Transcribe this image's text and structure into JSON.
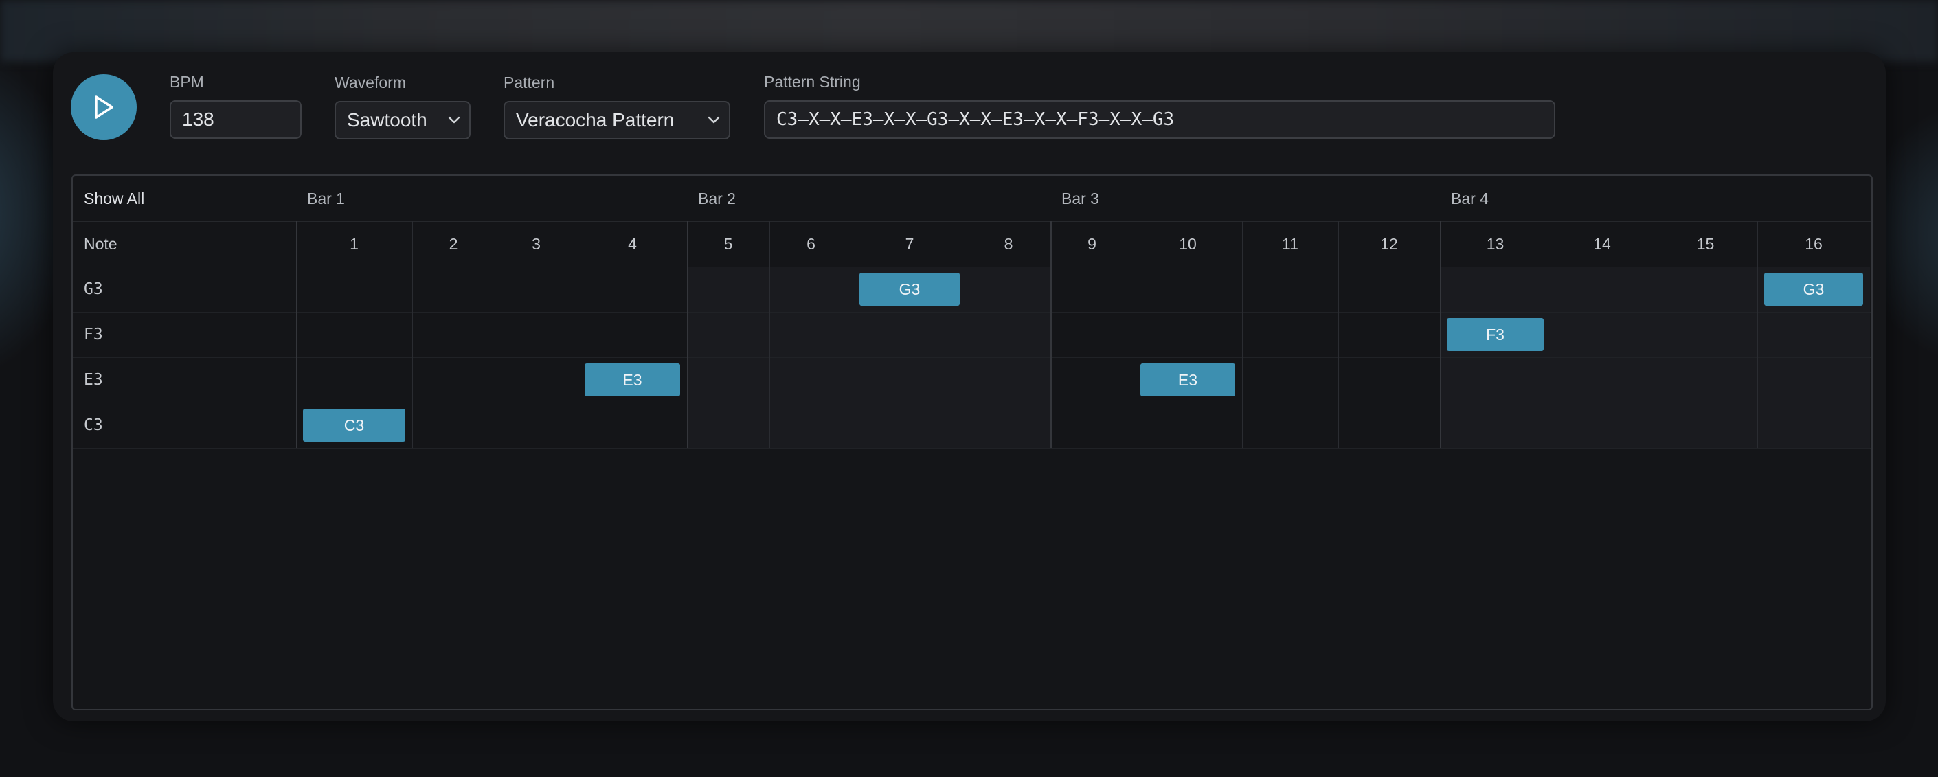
{
  "controls": {
    "bpm_label": "BPM",
    "bpm_value": "138",
    "waveform_label": "Waveform",
    "waveform_value": "Sawtooth",
    "pattern_label": "Pattern",
    "pattern_value": "Veracocha Pattern",
    "pattern_string_label": "Pattern String",
    "pattern_string_value": "C3–X–X–E3–X–X–G3–X–X–E3–X–X–F3–X–X–G3"
  },
  "grid": {
    "show_all_label": "Show All",
    "note_header": "Note",
    "bars": [
      "Bar 1",
      "Bar 2",
      "Bar 3",
      "Bar 4"
    ],
    "steps": [
      "1",
      "2",
      "3",
      "4",
      "5",
      "6",
      "7",
      "8",
      "9",
      "10",
      "11",
      "12",
      "13",
      "14",
      "15",
      "16"
    ],
    "rows": [
      "G3",
      "F3",
      "E3",
      "C3"
    ],
    "notes": [
      {
        "note": "C3",
        "step": 1
      },
      {
        "note": "E3",
        "step": 4
      },
      {
        "note": "G3",
        "step": 7
      },
      {
        "note": "E3",
        "step": 10
      },
      {
        "note": "F3",
        "step": 13
      },
      {
        "note": "G3",
        "step": 16
      }
    ]
  },
  "colors": {
    "accent": "#3d8fb0",
    "background": "#111215",
    "panel": "#151619"
  },
  "icons": {
    "play": "play-icon",
    "dropdown": "chevron-down-icon"
  }
}
